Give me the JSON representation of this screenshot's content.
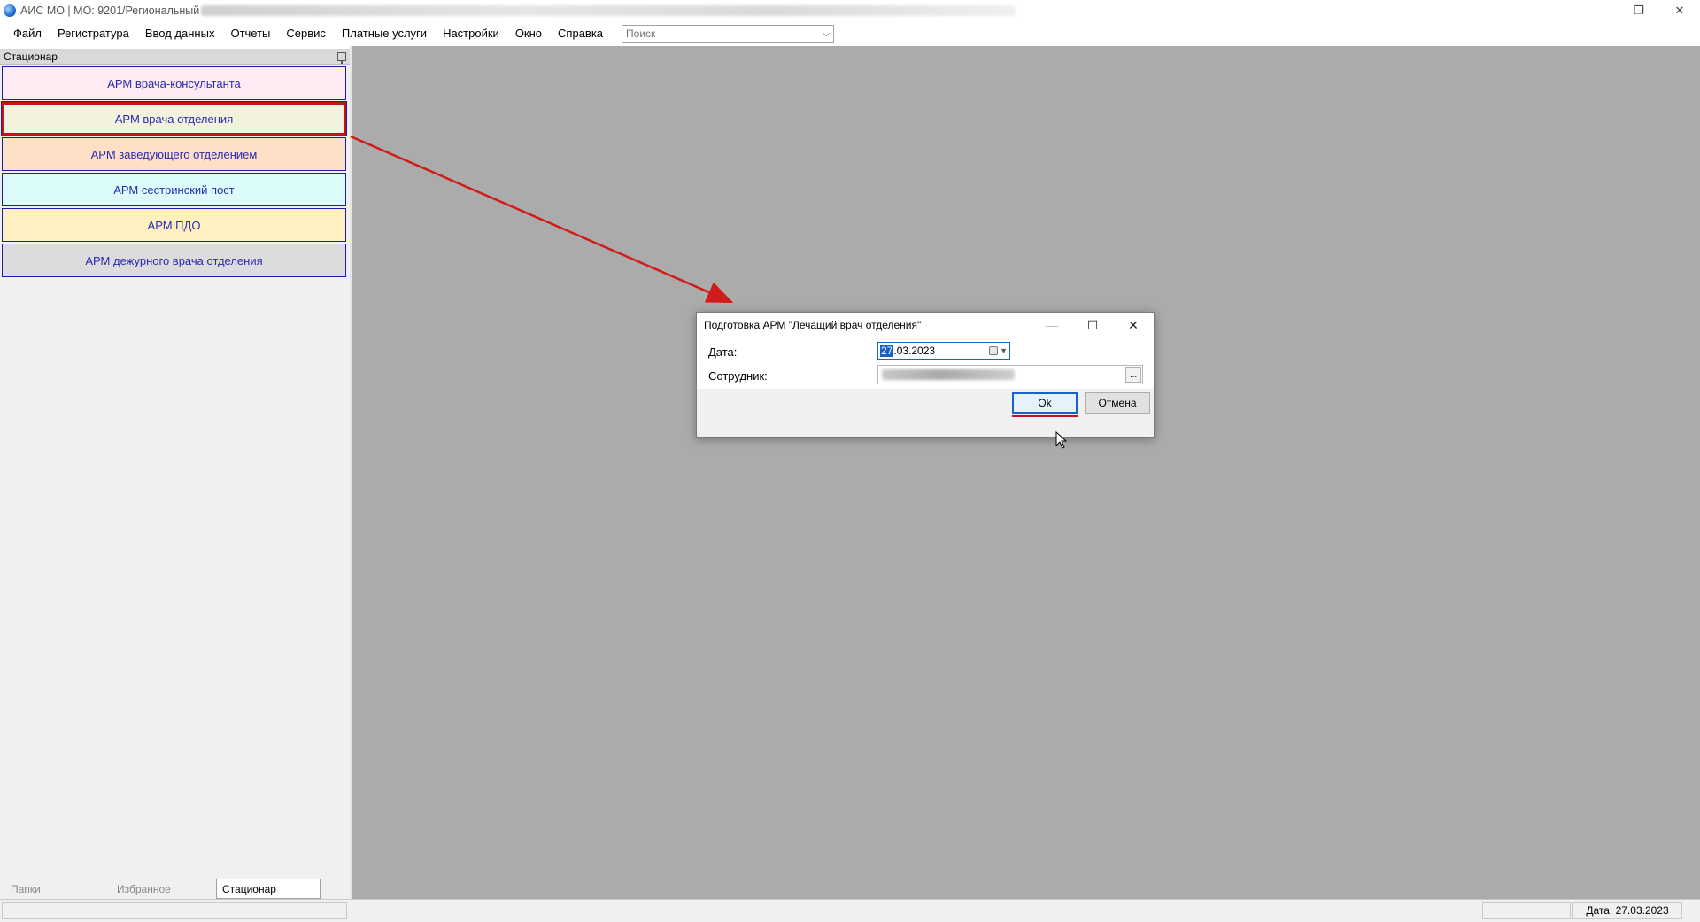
{
  "window": {
    "title": "АИС МО | МО: 9201/Региональный",
    "controls": {
      "minimize": "–",
      "restore": "❐",
      "close": "✕"
    }
  },
  "menu": [
    "Файл",
    "Регистратура",
    "Ввод данных",
    "Отчеты",
    "Сервис",
    "Платные услуги",
    "Настройки",
    "Окно",
    "Справка"
  ],
  "search": {
    "placeholder": "Поиск",
    "value": ""
  },
  "panel": {
    "title": "Стационар",
    "arm_buttons": [
      {
        "label": "АРМ врача-консультанта",
        "color": "#fdeaf2"
      },
      {
        "label": "АРМ врача отделения",
        "color": "#f3f3dd",
        "selected": true
      },
      {
        "label": "АРМ заведующего отделением",
        "color": "#fde0c6"
      },
      {
        "label": "АРМ сестринский пост",
        "color": "#dcfcfc"
      },
      {
        "label": "АРМ ПДО",
        "color": "#fff0c2"
      },
      {
        "label": "АРМ дежурного врача отделения",
        "color": "#dcdcdc"
      }
    ],
    "tabs": [
      {
        "label": "Папки",
        "active": false
      },
      {
        "label": "Избранное",
        "active": false
      },
      {
        "label": "Стационар",
        "active": true
      }
    ]
  },
  "dialog": {
    "title": "Подготовка АРМ \"Лечащий врач отделения\"",
    "date_label": "Дата:",
    "date_value_selected": "27",
    "date_value_rest": ".03.2023",
    "employee_label": "Сотрудник:",
    "dots_label": "...",
    "ok_label": "Ok",
    "cancel_label": "Отмена"
  },
  "status": {
    "date_text": "Дата: 27.03.2023"
  },
  "colors": {
    "highlight": "#c4121c",
    "workspace": "#ababab",
    "link_text": "#2a2ab0"
  }
}
